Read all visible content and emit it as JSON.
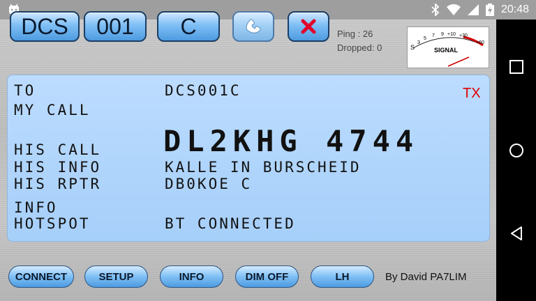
{
  "status_bar": {
    "time": "20:48",
    "battery_level": "charging",
    "icons": [
      "android-icon",
      "bluetooth-icon",
      "wifi-icon",
      "signal-icon",
      "battery-icon"
    ]
  },
  "top_buttons": {
    "mode": "DCS",
    "number": "001",
    "module": "C",
    "call_icon": "phone-icon",
    "cancel_icon": "close-icon"
  },
  "connection": {
    "ping": "Ping : 26",
    "dropped": "Dropped: 0"
  },
  "meter": {
    "label": "SIGNAL",
    "scale": [
      "S",
      "3",
      "5",
      "7",
      "9",
      "+10",
      "+30",
      "+60"
    ]
  },
  "lcd": {
    "to_label": "TO",
    "to_value": "DCS001C",
    "tx_label": "TX",
    "mycall_label": "MY CALL",
    "mycall_value": "",
    "hiscall_label": "HIS CALL",
    "hiscall_value": "DL2KHG 4744",
    "hisinfo_label": "HIS INFO",
    "hisinfo_value": "KALLE IN BURSCHEID",
    "hisrptr_label": "HIS RPTR",
    "hisrptr_value": "DB0KOE C",
    "info_label": "INFO",
    "hotspot_label": "HOTSPOT",
    "hotspot_value": "BT CONNECTED"
  },
  "bottom_buttons": {
    "connect": "CONNECT",
    "setup": "SETUP",
    "info": "INFO",
    "dim": "DIM OFF",
    "lh": "LH"
  },
  "byline": "By David PA7LIM",
  "colors": {
    "lcd_bg": "#a6cff9",
    "tx": "#e00000",
    "button": "#4d9be0",
    "cancel_x": "#e0002a"
  }
}
